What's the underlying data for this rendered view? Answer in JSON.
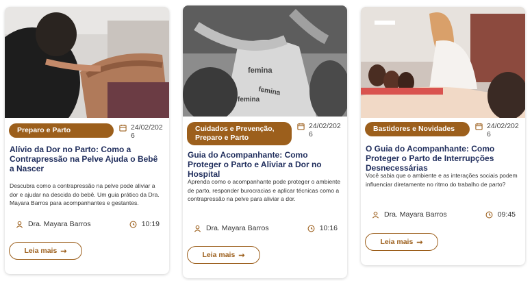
{
  "cards": [
    {
      "category": "Preparo e Parto",
      "date": "24/02/2026",
      "date_l1": "24/02/202",
      "date_l2": "6",
      "title": "Alívio da Dor no Parto: Como a Contrapressão na Pelve Ajuda o Bebê a Nascer",
      "description": "Descubra como a contrapressão na pelve pode aliviar a dor e ajudar na descida do bebê. Um guia prático da Dra. Mayara Barros para acompanhantes e gestantes.",
      "author": "Dra. Mayara Barros",
      "time": "10:19",
      "cta": "Leia mais"
    },
    {
      "category": "Cuidados e Prevenção, Preparo e Parto",
      "date": "24/02/2026",
      "date_l1": "24/02/202",
      "date_l2": "6",
      "title": "Guia do Acompanhante: Como Proteger o Parto e Aliviar a Dor no Hospital",
      "description": "Aprenda como o acompanhante pode proteger o ambiente de parto, responder burocracias e aplicar técnicas como a contrapressão na pelve para aliviar a dor.",
      "author": "Dra. Mayara Barros",
      "time": "10:16",
      "cta": "Leia mais",
      "image_text": "femina"
    },
    {
      "category": "Bastidores e Novidades",
      "date": "24/02/2026",
      "date_l1": "24/02/202",
      "date_l2": "6",
      "title": "O Guia do Acompanhante: Como Proteger o Parto de Interrupções Desnecessárias",
      "description": "Você sabia que o ambiente e as interações sociais podem influenciar diretamente no ritmo do trabalho de parto?",
      "author": "Dra. Mayara Barros",
      "time": "09:45",
      "cta": "Leia mais"
    }
  ],
  "colors": {
    "accent": "#9c5f1c",
    "title": "#1f2d5c"
  },
  "icons": {
    "date": "calendar-icon",
    "author": "user-icon",
    "time": "clock-icon",
    "cta": "arrow-right-icon"
  }
}
